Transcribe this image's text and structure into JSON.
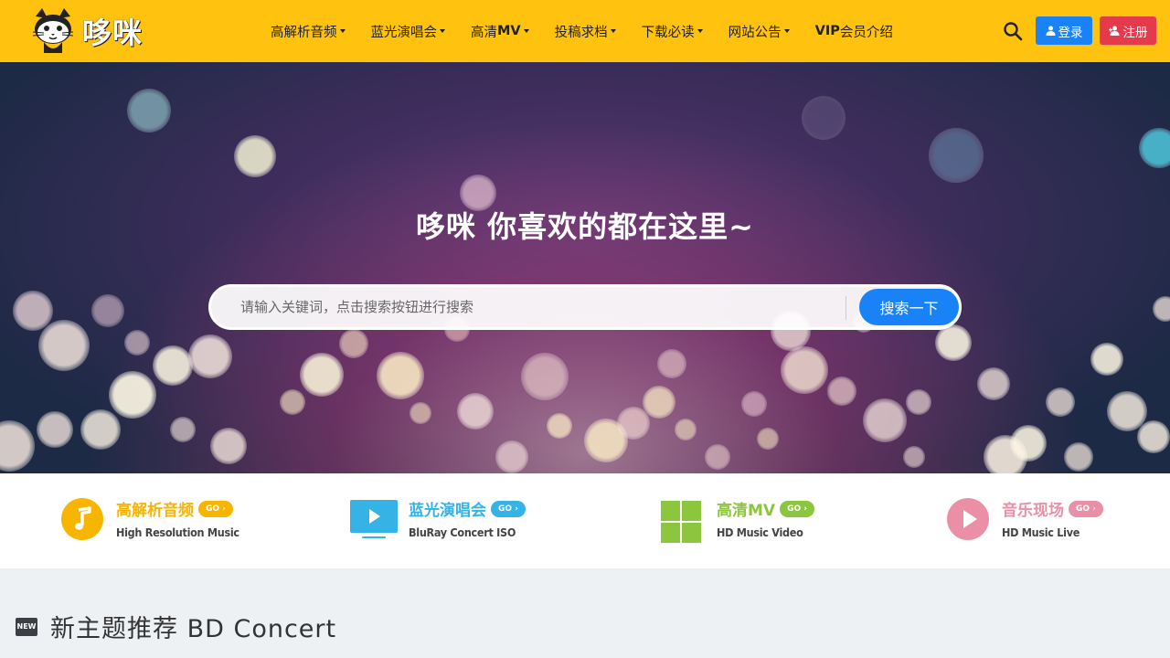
{
  "brand": {
    "logo_text": "哆咪",
    "primary": "#ffc20e"
  },
  "nav": {
    "items": [
      {
        "label": "高解析音频"
      },
      {
        "label": "蓝光演唱会"
      },
      {
        "label_prefix": "高清",
        "label_bold": "MV"
      },
      {
        "label": "投稿求档"
      },
      {
        "label": "下载必读"
      },
      {
        "label": "网站公告"
      },
      {
        "label_bold": "VIP",
        "label_suffix": "会员介绍"
      }
    ],
    "login_label": "登录",
    "register_label": "注册",
    "search_icon": "search-icon"
  },
  "hero": {
    "title": "哆咪 你喜欢的都在这里~",
    "search_placeholder": "请输入关键词，点击搜索按钮进行搜索",
    "search_button": "搜索一下"
  },
  "categories": [
    {
      "title": "高解析音频",
      "go": "GO ›",
      "sub": "High Resolution Music",
      "color": "#f7b500",
      "icon": "music-note-icon"
    },
    {
      "title": "蓝光演唱会",
      "go": "GO ›",
      "sub": "BluRay Concert ISO",
      "color": "#36b3e6",
      "icon": "video-screen-icon"
    },
    {
      "title": "高清MV",
      "go": "GO ›",
      "sub": "HD Music Video",
      "color": "#8cc63f",
      "icon": "grid-icon"
    },
    {
      "title": "音乐现场",
      "go": "GO ›",
      "sub": "HD Music Live",
      "color": "#ea8fa6",
      "icon": "play-circle-icon"
    }
  ],
  "section": {
    "badge": "NEW",
    "title": "新主题推荐 BD Concert"
  }
}
